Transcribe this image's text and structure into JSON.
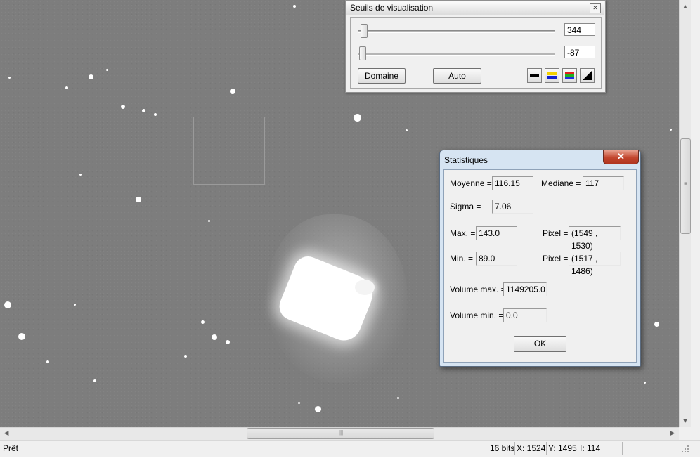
{
  "seuils": {
    "title": "Seuils de visualisation",
    "high_value": "344",
    "low_value": "-87",
    "domaine_label": "Domaine",
    "auto_label": "Auto",
    "palette_icons": [
      "palette-black-icon",
      "palette-yellow-blue-icon",
      "palette-rgb-icon",
      "palette-gradient-icon"
    ]
  },
  "stats": {
    "title": "Statistiques",
    "close_glyph": "✕",
    "moyenne_label": "Moyenne =",
    "moyenne_value": "116.15",
    "mediane_label": "Mediane =",
    "mediane_value": "117",
    "sigma_label": "Sigma =",
    "sigma_value": "7.06",
    "max_label": "Max. =",
    "max_value": "143.0",
    "max_pixel_label": "Pixel =",
    "max_pixel_value": "(1549 , 1530)",
    "min_label": "Min. =",
    "min_value": "89.0",
    "min_pixel_label": "Pixel =",
    "min_pixel_value": "(1517 , 1486)",
    "volmax_label": "Volume max. =",
    "volmax_value": "1149205.0",
    "volmin_label": "Volume min. =",
    "volmin_value": "0.0",
    "ok_label": "OK"
  },
  "statusbar": {
    "status": "Prêt",
    "bits": "16 bits",
    "x": "X: 1524",
    "y": "Y: 1495",
    "intensity": "I: 114"
  },
  "scroll": {
    "up": "▲",
    "down": "▼",
    "left": "◀",
    "right": "▶",
    "grip_v": "≡",
    "grip_h": "|||"
  }
}
